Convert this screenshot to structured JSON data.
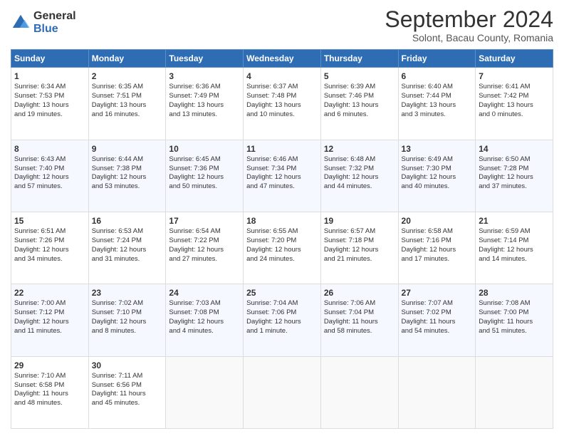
{
  "header": {
    "logo_general": "General",
    "logo_blue": "Blue",
    "month_title": "September 2024",
    "subtitle": "Solont, Bacau County, Romania"
  },
  "days_of_week": [
    "Sunday",
    "Monday",
    "Tuesday",
    "Wednesday",
    "Thursday",
    "Friday",
    "Saturday"
  ],
  "weeks": [
    [
      {
        "day": "1",
        "lines": [
          "Sunrise: 6:34 AM",
          "Sunset: 7:53 PM",
          "Daylight: 13 hours",
          "and 19 minutes."
        ]
      },
      {
        "day": "2",
        "lines": [
          "Sunrise: 6:35 AM",
          "Sunset: 7:51 PM",
          "Daylight: 13 hours",
          "and 16 minutes."
        ]
      },
      {
        "day": "3",
        "lines": [
          "Sunrise: 6:36 AM",
          "Sunset: 7:49 PM",
          "Daylight: 13 hours",
          "and 13 minutes."
        ]
      },
      {
        "day": "4",
        "lines": [
          "Sunrise: 6:37 AM",
          "Sunset: 7:48 PM",
          "Daylight: 13 hours",
          "and 10 minutes."
        ]
      },
      {
        "day": "5",
        "lines": [
          "Sunrise: 6:39 AM",
          "Sunset: 7:46 PM",
          "Daylight: 13 hours",
          "and 6 minutes."
        ]
      },
      {
        "day": "6",
        "lines": [
          "Sunrise: 6:40 AM",
          "Sunset: 7:44 PM",
          "Daylight: 13 hours",
          "and 3 minutes."
        ]
      },
      {
        "day": "7",
        "lines": [
          "Sunrise: 6:41 AM",
          "Sunset: 7:42 PM",
          "Daylight: 13 hours",
          "and 0 minutes."
        ]
      }
    ],
    [
      {
        "day": "8",
        "lines": [
          "Sunrise: 6:43 AM",
          "Sunset: 7:40 PM",
          "Daylight: 12 hours",
          "and 57 minutes."
        ]
      },
      {
        "day": "9",
        "lines": [
          "Sunrise: 6:44 AM",
          "Sunset: 7:38 PM",
          "Daylight: 12 hours",
          "and 53 minutes."
        ]
      },
      {
        "day": "10",
        "lines": [
          "Sunrise: 6:45 AM",
          "Sunset: 7:36 PM",
          "Daylight: 12 hours",
          "and 50 minutes."
        ]
      },
      {
        "day": "11",
        "lines": [
          "Sunrise: 6:46 AM",
          "Sunset: 7:34 PM",
          "Daylight: 12 hours",
          "and 47 minutes."
        ]
      },
      {
        "day": "12",
        "lines": [
          "Sunrise: 6:48 AM",
          "Sunset: 7:32 PM",
          "Daylight: 12 hours",
          "and 44 minutes."
        ]
      },
      {
        "day": "13",
        "lines": [
          "Sunrise: 6:49 AM",
          "Sunset: 7:30 PM",
          "Daylight: 12 hours",
          "and 40 minutes."
        ]
      },
      {
        "day": "14",
        "lines": [
          "Sunrise: 6:50 AM",
          "Sunset: 7:28 PM",
          "Daylight: 12 hours",
          "and 37 minutes."
        ]
      }
    ],
    [
      {
        "day": "15",
        "lines": [
          "Sunrise: 6:51 AM",
          "Sunset: 7:26 PM",
          "Daylight: 12 hours",
          "and 34 minutes."
        ]
      },
      {
        "day": "16",
        "lines": [
          "Sunrise: 6:53 AM",
          "Sunset: 7:24 PM",
          "Daylight: 12 hours",
          "and 31 minutes."
        ]
      },
      {
        "day": "17",
        "lines": [
          "Sunrise: 6:54 AM",
          "Sunset: 7:22 PM",
          "Daylight: 12 hours",
          "and 27 minutes."
        ]
      },
      {
        "day": "18",
        "lines": [
          "Sunrise: 6:55 AM",
          "Sunset: 7:20 PM",
          "Daylight: 12 hours",
          "and 24 minutes."
        ]
      },
      {
        "day": "19",
        "lines": [
          "Sunrise: 6:57 AM",
          "Sunset: 7:18 PM",
          "Daylight: 12 hours",
          "and 21 minutes."
        ]
      },
      {
        "day": "20",
        "lines": [
          "Sunrise: 6:58 AM",
          "Sunset: 7:16 PM",
          "Daylight: 12 hours",
          "and 17 minutes."
        ]
      },
      {
        "day": "21",
        "lines": [
          "Sunrise: 6:59 AM",
          "Sunset: 7:14 PM",
          "Daylight: 12 hours",
          "and 14 minutes."
        ]
      }
    ],
    [
      {
        "day": "22",
        "lines": [
          "Sunrise: 7:00 AM",
          "Sunset: 7:12 PM",
          "Daylight: 12 hours",
          "and 11 minutes."
        ]
      },
      {
        "day": "23",
        "lines": [
          "Sunrise: 7:02 AM",
          "Sunset: 7:10 PM",
          "Daylight: 12 hours",
          "and 8 minutes."
        ]
      },
      {
        "day": "24",
        "lines": [
          "Sunrise: 7:03 AM",
          "Sunset: 7:08 PM",
          "Daylight: 12 hours",
          "and 4 minutes."
        ]
      },
      {
        "day": "25",
        "lines": [
          "Sunrise: 7:04 AM",
          "Sunset: 7:06 PM",
          "Daylight: 12 hours",
          "and 1 minute."
        ]
      },
      {
        "day": "26",
        "lines": [
          "Sunrise: 7:06 AM",
          "Sunset: 7:04 PM",
          "Daylight: 11 hours",
          "and 58 minutes."
        ]
      },
      {
        "day": "27",
        "lines": [
          "Sunrise: 7:07 AM",
          "Sunset: 7:02 PM",
          "Daylight: 11 hours",
          "and 54 minutes."
        ]
      },
      {
        "day": "28",
        "lines": [
          "Sunrise: 7:08 AM",
          "Sunset: 7:00 PM",
          "Daylight: 11 hours",
          "and 51 minutes."
        ]
      }
    ],
    [
      {
        "day": "29",
        "lines": [
          "Sunrise: 7:10 AM",
          "Sunset: 6:58 PM",
          "Daylight: 11 hours",
          "and 48 minutes."
        ]
      },
      {
        "day": "30",
        "lines": [
          "Sunrise: 7:11 AM",
          "Sunset: 6:56 PM",
          "Daylight: 11 hours",
          "and 45 minutes."
        ]
      },
      {
        "day": "",
        "lines": []
      },
      {
        "day": "",
        "lines": []
      },
      {
        "day": "",
        "lines": []
      },
      {
        "day": "",
        "lines": []
      },
      {
        "day": "",
        "lines": []
      }
    ]
  ]
}
